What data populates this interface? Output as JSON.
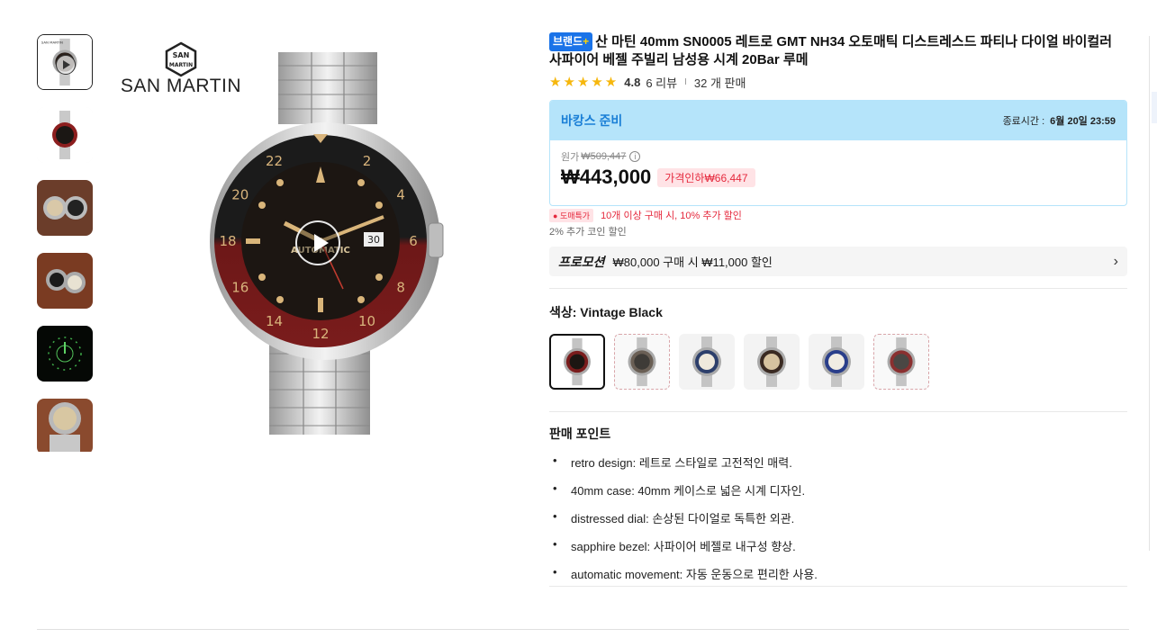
{
  "gallery": {
    "thumbnails": [
      {
        "name": "thumb-video",
        "type": "video"
      },
      {
        "name": "thumb-black-dial"
      },
      {
        "name": "thumb-two-watches"
      },
      {
        "name": "thumb-watch-pair"
      },
      {
        "name": "thumb-lume"
      },
      {
        "name": "thumb-wrist"
      }
    ],
    "brand_text": "SAN MARTIN",
    "emblem_text_1": "SAN",
    "emblem_text_2": "MARTIN"
  },
  "product": {
    "brand_badge": "브랜드",
    "brand_badge_plus": "+",
    "title": "산 마틴 40mm SN0005 레트로 GMT NH34 오토매틱 디스트레스드 파티나 다이얼 바이컬러 사파이어 베젤 주빌리 남성용 시계 20Bar 루메",
    "rating": {
      "stars": "★★★★★",
      "score": "4.8",
      "reviews": "6 리뷰",
      "separator": "I",
      "sold": "32 개 판매"
    }
  },
  "deal": {
    "label": "바캉스 준비",
    "end_label": "종료시간 :",
    "end_time": "6월 20일 23:59",
    "orig_label": "원가",
    "orig_price": "₩509,447",
    "info_icon": "i",
    "price": "₩443,000",
    "discount": "가격인하₩66,447"
  },
  "bulk": {
    "tag": "도매특가",
    "text": "10개 이상 구매 시, 10% 추가 할인"
  },
  "coin": "2% 추가 코인 할인",
  "promo": {
    "label": "프로모션",
    "text": "₩80,000 구매 시 ₩11,000 할인",
    "chevron": "›"
  },
  "color": {
    "title": "색상: Vintage Black",
    "options": [
      "Vintage Black",
      "Option 2",
      "Option 3",
      "Option 4",
      "Option 5",
      "Option 6"
    ]
  },
  "selling_points": {
    "title": "판매 포인트",
    "items": [
      "retro design: 레트로 스타일로 고전적인 매력.",
      "40mm case: 40mm 케이스로 넓은 시계 디자인.",
      "distressed dial: 손상된 다이얼로 독특한 외관.",
      "sapphire bezel: 사파이어 베젤로 내구성 향상.",
      "automatic movement: 자동 운동으로 편리한 사용."
    ]
  },
  "watch_face": {
    "bezel_numbers": [
      "2",
      "4",
      "6",
      "8",
      "10",
      "12",
      "14",
      "16",
      "18",
      "20",
      "22"
    ],
    "date": "30",
    "dial_text": "AUTOMATIC"
  },
  "colors": {
    "accent_blue": "#1a73e8",
    "deal_bg": "#b5e4fa",
    "discount_red": "#e5293d",
    "star_yellow": "#f6b70d"
  }
}
